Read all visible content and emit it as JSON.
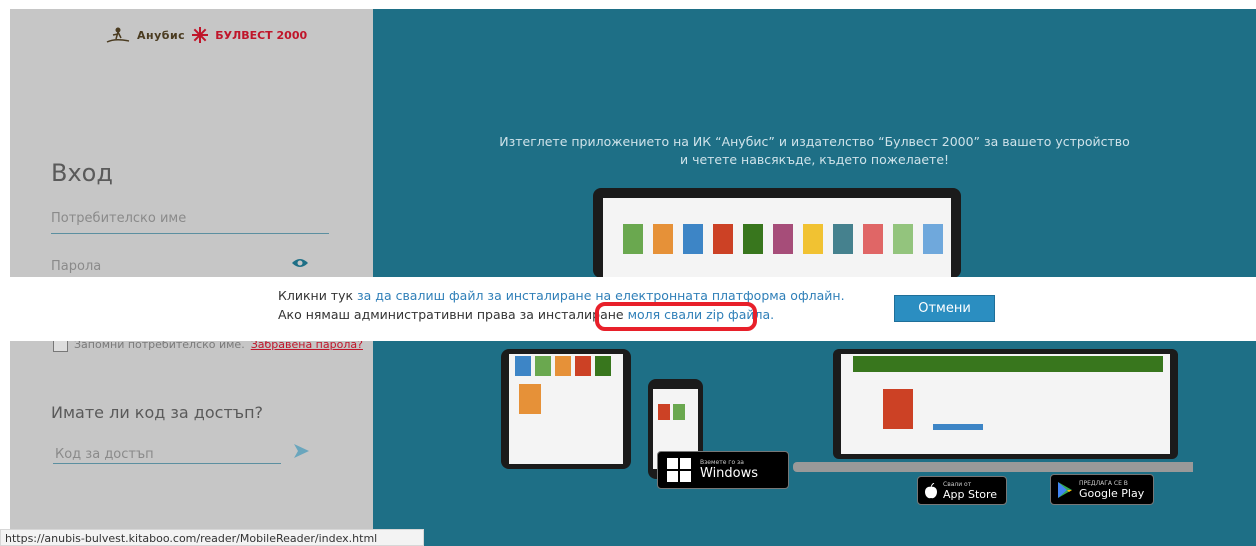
{
  "left_panel": {
    "logo": {
      "anubis": "Анубис",
      "bulvest": "БУЛВЕСТ 2000"
    },
    "login_title": "Вход",
    "username_placeholder": "Потребителско име",
    "password_placeholder": "Парола",
    "remember_label": "Запомни потребителско име.",
    "forgot_link": "Забравена парола?",
    "access_title": "Имате ли код за достъп?",
    "access_placeholder": "Код за достъп"
  },
  "promo": {
    "line1": "Изтеглете приложението на ИК “Анубис” и издателство “Булвест 2000” за вашето устройство",
    "line2": "и четете навсякъде, където пожелаете!"
  },
  "stores": {
    "windows_small": "Вземете го за",
    "windows_big": "Windows",
    "appstore_small": "Свали от",
    "appstore_big": "App Store",
    "googleplay_small": "ПРЕДЛАГА СЕ В",
    "googleplay_big": "Google Play"
  },
  "banner": {
    "line1_prefix": "Кликни тук ",
    "line1_link": "за да свалиш файл за инсталиране на електронната платформа офлайн.",
    "line2_prefix": "Ако нямаш административни права за инсталиране ",
    "line2_link": "моля свали zip файла.",
    "cancel_label": "Отмени"
  },
  "status_bar": {
    "url": "https://anubis-bulvest.kitaboo.com/reader/MobileReader/index.html"
  },
  "colors": {
    "left_bg": "#c6c6c6",
    "right_bg": "#1e6f86",
    "accent": "#2b8ec1",
    "highlight": "#e8202a"
  }
}
